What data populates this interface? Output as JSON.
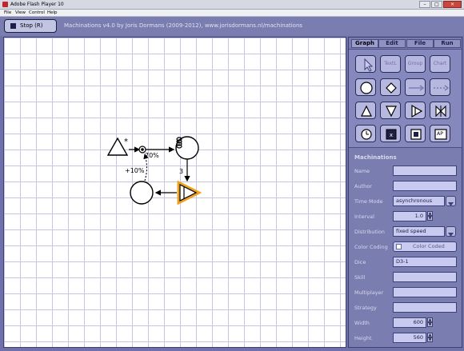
{
  "window": {
    "title": "Adobe Flash Player 10",
    "min_glyph": "–",
    "max_glyph": "□",
    "close_glyph": "×",
    "menus": [
      "File",
      "View",
      "Control",
      "Help"
    ]
  },
  "toolbar": {
    "stop_label": "Stop (R)",
    "app_title": "Machinations v4.0 by Joris Dormans (2009-2012), www.jorisdormans.nl/machinations"
  },
  "diagram": {
    "source_marker": "*",
    "probability_label": "70%",
    "modifier_label": "+10%",
    "flow_rate_label": "3"
  },
  "panel": {
    "tabs": [
      "Graph",
      "Edit",
      "File",
      "Run"
    ],
    "tool_labels": {
      "text": "TextL",
      "group": "Group",
      "chart": "Chart",
      "ap": "AP"
    },
    "section_title": "Machinations",
    "fields": {
      "name": {
        "label": "Name",
        "value": ""
      },
      "author": {
        "label": "Author",
        "value": ""
      },
      "time_mode": {
        "label": "Time Mode",
        "value": "asynchronous"
      },
      "interval": {
        "label": "Interval",
        "value": "1.0"
      },
      "distribution": {
        "label": "Distribution",
        "value": "fixed speed"
      },
      "color_coding": {
        "label": "Color Coding",
        "value": "Color Coded"
      },
      "dice": {
        "label": "Dice",
        "value": "D3-1"
      },
      "skill": {
        "label": "Skill",
        "value": ""
      },
      "multiplayer": {
        "label": "Multiplayer",
        "value": ""
      },
      "strategy": {
        "label": "Strategy",
        "value": ""
      },
      "width": {
        "label": "Width",
        "value": "600"
      },
      "height": {
        "label": "Height",
        "value": "560"
      }
    }
  },
  "colors": {
    "chrome": "#7a7db0",
    "highlight": "#f0a020",
    "grid": "#c5c6e4"
  }
}
